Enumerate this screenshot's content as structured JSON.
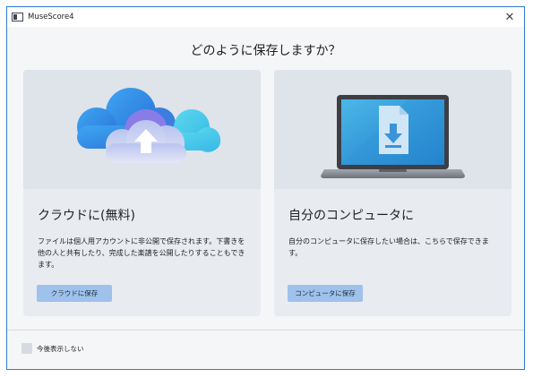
{
  "window": {
    "title": "MuseScore4",
    "icons": {
      "app": "app-window-icon",
      "close": "close-icon"
    }
  },
  "dialog": {
    "heading": "どのように保存しますか？"
  },
  "cloud_card": {
    "title": "クラウドに(無料)",
    "description": "ファイルは個人用アカウントに非公開で保存されます。下書きを他の人と共有したり、完成した楽譜を公開したりすることもできます。",
    "button_label": "クラウドに保存",
    "illustration": "cloud-upload-icon"
  },
  "computer_card": {
    "title": "自分のコンピュータに",
    "description": "自分のコンピュータに保存したい場合は、こちらで保存できます。",
    "button_label": "コンピュータに保存",
    "illustration": "laptop-download-icon"
  },
  "footer": {
    "dont_show_label": "今後表示しない",
    "checked": false
  },
  "colors": {
    "accent": "#2f7bd3",
    "button": "#9ec2ec",
    "card": "#e8ebf0"
  }
}
